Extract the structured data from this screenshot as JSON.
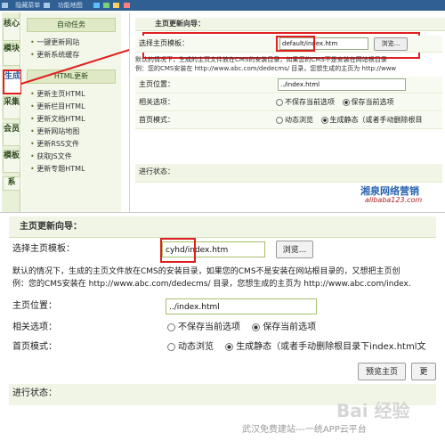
{
  "topbar": {
    "items": [
      "隐藏菜单",
      "功能地图"
    ]
  },
  "vtabs": [
    "核心",
    "模块",
    "生成",
    "采集",
    "会员",
    "模板",
    "系"
  ],
  "left_menu": {
    "section1": {
      "title": "自动任务",
      "items": [
        "一键更新网站",
        "更新系统缓存"
      ]
    },
    "section2": {
      "title": "HTML更新",
      "items": [
        "更新主页HTML",
        "更新栏目HTML",
        "更新文档HTML",
        "更新网站地图",
        "更新RSS文件",
        "获取JS文件",
        "更新专题HTML"
      ]
    }
  },
  "top_form": {
    "header": "主页更新向导：",
    "template_label": "选择主页模板：",
    "template_prefix": "default",
    "template_value": "/index.htm",
    "browse": "浏览...",
    "desc1": "默认的情况下，生成的主页文件放在CMS的安装目录，如果您的CMS不是安装在网站根目录",
    "desc2": "例：您的CMS安装在 http://www.abc.com/dedecms/ 目录，您想生成的主页为 http://www",
    "position_label": "主页位置：",
    "position_value": "../index.html",
    "options_label": "相关选项：",
    "opt_no_save": "不保存当前选项",
    "opt_save": "保存当前选项",
    "mode_label": "首页模式：",
    "mode_dynamic": "动态浏览",
    "mode_static": "生成静态（或者手动删除根目",
    "progress_label": "进行状态："
  },
  "watermark": {
    "line1": "湘泉网络营销",
    "line2": "alibaba123.com"
  },
  "bottom_form": {
    "header": "主页更新向导：",
    "template_label": "选择主页模板：",
    "template_prefix": "cyhd",
    "template_value": "/index.htm",
    "browse": "浏览...",
    "desc1": "默认的情况下，生成的主页文件放在CMS的安装目录，如果您的CMS不是安装在网站根目录的，又想把主页创",
    "desc2": "例：您的CMS安装在 http://www.abc.com/dedecms/ 目录，您想生成的主页为 http://www.abc.com/index.",
    "position_label": "主页位置：",
    "position_value": "../index.html",
    "options_label": "相关选项：",
    "opt_no_save": "不保存当前选项",
    "opt_save": "保存当前选项",
    "mode_label": "首页模式：",
    "mode_dynamic": "动态浏览",
    "mode_static": "生成静态（或者手动删除根目录下index.html文",
    "preview": "预览主页",
    "update": "更",
    "progress_label": "进行状态："
  },
  "footer": {
    "text": "武汉免费建站---一统APP云平台",
    "baidu": "Bai 经验"
  }
}
